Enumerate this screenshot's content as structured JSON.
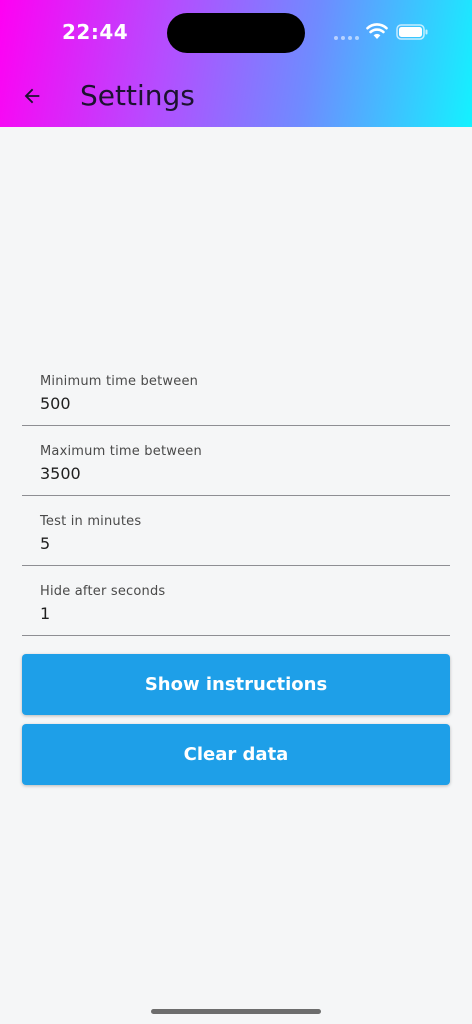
{
  "status_bar": {
    "time": "22:44"
  },
  "app_bar": {
    "title": "Settings",
    "back_icon": "arrow-left-icon"
  },
  "fields": [
    {
      "label": "Minimum time between",
      "value": "500"
    },
    {
      "label": "Maximum time between",
      "value": "3500"
    },
    {
      "label": "Test in minutes",
      "value": "5"
    },
    {
      "label": "Hide after seconds",
      "value": "1"
    }
  ],
  "buttons": {
    "show_instructions": "Show instructions",
    "clear_data": "Clear data"
  },
  "colors": {
    "gradient_start": "#ff00f3",
    "gradient_end": "#13f2ff",
    "button": "#1e9fe8",
    "background": "#f5f6f7"
  }
}
